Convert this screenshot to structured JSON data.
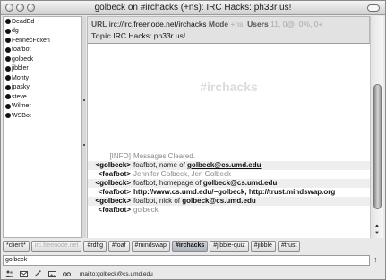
{
  "window": {
    "title": "golbeck on #irchacks (+ns): IRC Hacks: ph33r us!"
  },
  "nicklist": {
    "nicks": [
      "DeadEd",
      "dg",
      "FennecFoxen",
      "foafbot",
      "golbeck",
      "jibbler",
      "Monty",
      "jpasky",
      "steve",
      "Wilmer",
      "WSBot"
    ]
  },
  "channel": {
    "url_label": "URL",
    "url_value": "irc://irc.freenode.net/irchacks",
    "mode_label": "Mode",
    "mode_value": "+ns",
    "users_label": "Users",
    "users_value": "11, 0@, 0%, 0+",
    "topic_label": "Topic",
    "topic_value": "IRC Hacks: ph33r us!",
    "watermark": "#irchacks"
  },
  "messages": [
    {
      "who": "[INFO]",
      "kind": "info",
      "text": "Messages Cleared.",
      "grey": true
    },
    {
      "who": "<golbeck>",
      "kind": "me",
      "pre": "foafbot, name of ",
      "bold": "golbeck@cs.umd.edu",
      "underline": true
    },
    {
      "who": "<foafbot>",
      "kind": "other",
      "text": "Jennifer Golbeck, Jen Golbeck",
      "grey": true
    },
    {
      "who": "<golbeck>",
      "kind": "me",
      "pre": "foafbot, homepage of ",
      "bold": "golbeck@cs.umd.edu"
    },
    {
      "who": "<foafbot>",
      "kind": "other",
      "bold": "http://www.cs.umd.edu/~golbeck, http://trust.mindswap.org",
      "pre": ""
    },
    {
      "who": "<golbeck>",
      "kind": "me",
      "pre": "foafbot, nick of ",
      "bold": "golbeck@cs.umd.edu"
    },
    {
      "who": "<foafbot>",
      "kind": "other",
      "text": "golbeck",
      "grey": true
    }
  ],
  "tabs": [
    "*client*",
    "irc.freenode.net",
    "#rdfig",
    "#foaf",
    "#mindswap",
    "#irchacks",
    "#jibble-quiz",
    "#jibble",
    "#trust"
  ],
  "tabs_state": {
    "active": "#irchacks",
    "dim": "irc.freenode.net"
  },
  "input": {
    "value": "golbeck"
  },
  "status": {
    "icons": [
      "people-icon",
      "mail-icon",
      "wand-icon",
      "image-icon",
      "glasses-icon"
    ],
    "text": "mailto:golbeck@cs.umd.edu"
  }
}
